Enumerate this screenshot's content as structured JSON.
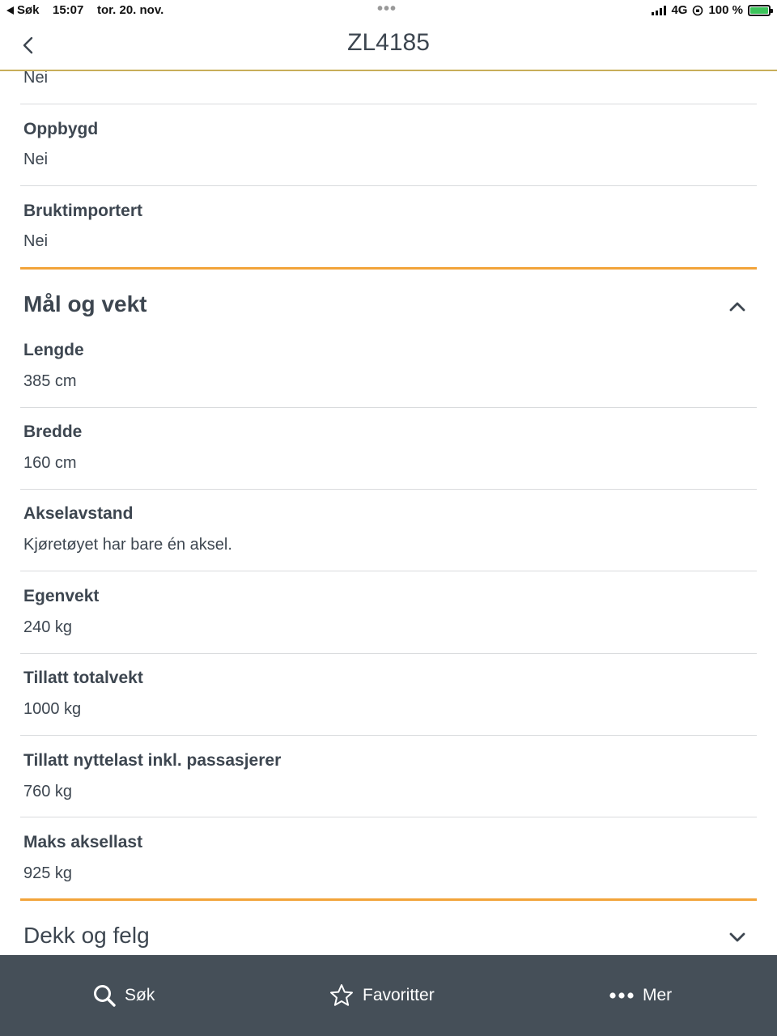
{
  "status_bar": {
    "back_app": "Søk",
    "time": "15:07",
    "date": "tor. 20. nov.",
    "network": "4G",
    "battery": "100 %"
  },
  "nav": {
    "title": "ZL4185"
  },
  "top_partial_value": "Nei",
  "upper_fields": [
    {
      "label": "Oppbygd",
      "value": "Nei"
    },
    {
      "label": "Bruktimportert",
      "value": "Nei"
    }
  ],
  "section_maal": {
    "title": "Mål og vekt",
    "expanded": true,
    "fields": [
      {
        "label": "Lengde",
        "value": "385 cm"
      },
      {
        "label": "Bredde",
        "value": "160 cm"
      },
      {
        "label": "Akselavstand",
        "value": "Kjøretøyet har bare én aksel."
      },
      {
        "label": "Egenvekt",
        "value": "240 kg"
      },
      {
        "label": "Tillatt totalvekt",
        "value": "1000 kg"
      },
      {
        "label": "Tillatt nyttelast inkl. passasjerer",
        "value": "760 kg"
      },
      {
        "label": "Maks aksellast",
        "value": "925 kg"
      }
    ]
  },
  "section_dekk": {
    "title": "Dekk og felg",
    "expanded": false
  },
  "tab_bar": {
    "search_label": "Søk",
    "favorites_label": "Favoritter",
    "more_label": "Mer"
  },
  "colors": {
    "accent": "#f2a43a",
    "nav_border": "#c8ae5a",
    "text": "#3d4650",
    "tab_bar_bg": "#454f58",
    "divider": "#d9dbdd"
  }
}
